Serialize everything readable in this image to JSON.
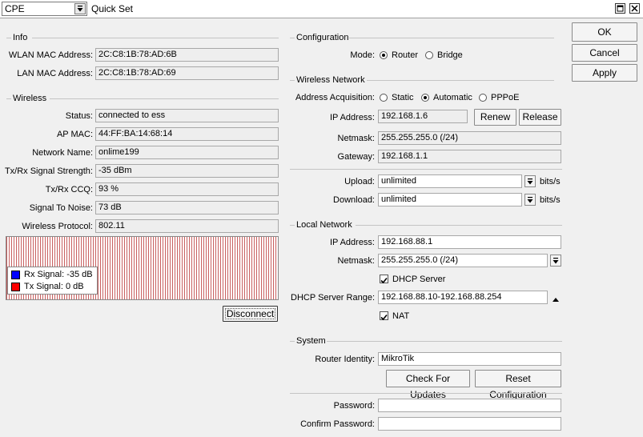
{
  "titlebar": {
    "mode_value": "CPE",
    "title": "Quick Set"
  },
  "info": {
    "section": "Info",
    "wlan_mac_label": "WLAN MAC Address:",
    "wlan_mac_value": "2C:C8:1B:78:AD:6B",
    "lan_mac_label": "LAN MAC Address:",
    "lan_mac_value": "2C:C8:1B:78:AD:69"
  },
  "wireless": {
    "section": "Wireless",
    "status_label": "Status:",
    "status_value": "connected to ess",
    "ap_mac_label": "AP MAC:",
    "ap_mac_value": "44:FF:BA:14:68:14",
    "network_name_label": "Network Name:",
    "network_name_value": "onlime199",
    "signal_strength_label": "Tx/Rx Signal Strength:",
    "signal_strength_value": "-35 dBm",
    "ccq_label": "Tx/Rx CCQ:",
    "ccq_value": "93 %",
    "snr_label": "Signal To Noise:",
    "snr_value": "73 dB",
    "protocol_label": "Wireless Protocol:",
    "protocol_value": "802.11",
    "legend_rx": "Rx Signal:  -35 dB",
    "legend_tx": "Tx Signal:   0 dB",
    "rx_color": "#0000ff",
    "tx_color": "#ff0000",
    "disconnect_label": "Disconnect"
  },
  "configuration": {
    "section": "Configuration",
    "mode_label": "Mode:",
    "mode_router": "Router",
    "mode_bridge": "Bridge",
    "mode_selected": "Router"
  },
  "wireless_network": {
    "section": "Wireless Network",
    "acq_label": "Address Acquisition:",
    "acq_static": "Static",
    "acq_automatic": "Automatic",
    "acq_pppoe": "PPPoE",
    "acq_selected": "Automatic",
    "ip_label": "IP Address:",
    "ip_value": "192.168.1.6",
    "renew_label": "Renew",
    "release_label": "Release",
    "netmask_label": "Netmask:",
    "netmask_value": "255.255.255.0 (/24)",
    "gateway_label": "Gateway:",
    "gateway_value": "192.168.1.1",
    "upload_label": "Upload:",
    "upload_value": "unlimited",
    "upload_unit": "bits/s",
    "download_label": "Download:",
    "download_value": "unlimited",
    "download_unit": "bits/s"
  },
  "local_network": {
    "section": "Local Network",
    "ip_label": "IP Address:",
    "ip_value": "192.168.88.1",
    "netmask_label": "Netmask:",
    "netmask_value": "255.255.255.0 (/24)",
    "dhcp_server_label": "DHCP Server",
    "dhcp_server_checked": true,
    "dhcp_range_label": "DHCP Server Range:",
    "dhcp_range_value": "192.168.88.10-192.168.88.254",
    "nat_label": "NAT",
    "nat_checked": true
  },
  "system": {
    "section": "System",
    "identity_label": "Router Identity:",
    "identity_value": "MikroTik",
    "check_updates_label": "Check For Updates",
    "reset_config_label": "Reset Configuration",
    "password_label": "Password:",
    "password_value": "",
    "confirm_password_label": "Confirm Password:",
    "confirm_password_value": ""
  },
  "actions": {
    "ok_label": "OK",
    "cancel_label": "Cancel",
    "apply_label": "Apply"
  }
}
